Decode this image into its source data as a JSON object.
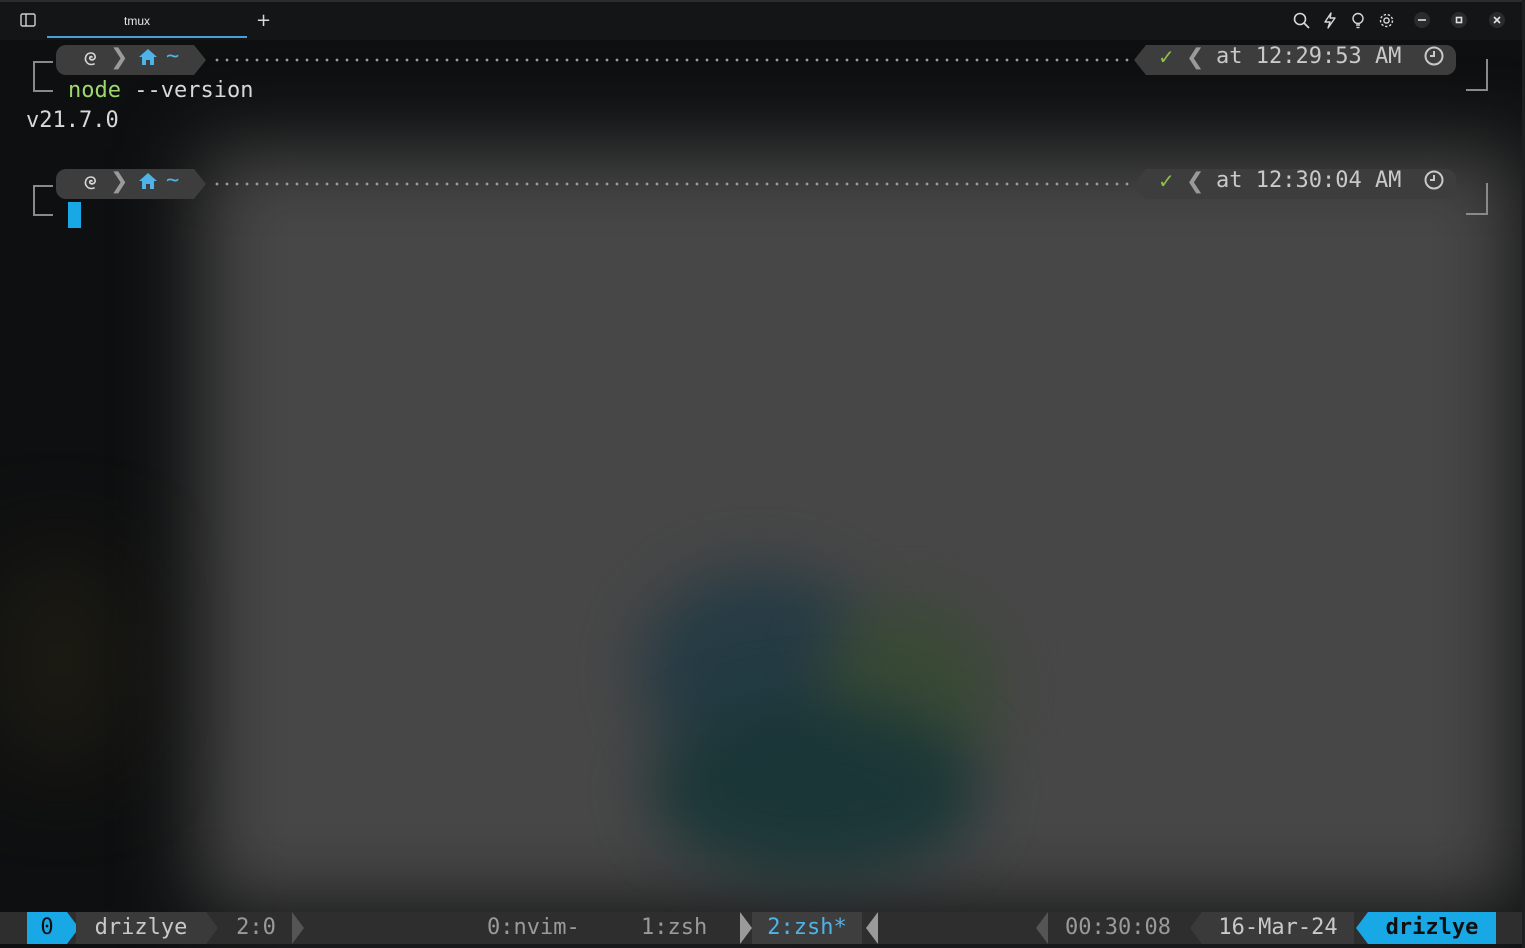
{
  "window": {
    "tab_title": "tmux",
    "new_tab_icon": "plus-icon",
    "sidebar_icon": "sidebar-toggle-icon",
    "toolbar_icons": [
      "search-icon",
      "lightning-icon",
      "lightbulb-icon",
      "gear-icon"
    ],
    "controls": [
      "minimize-icon",
      "maximize-icon",
      "close-icon"
    ]
  },
  "terminal": {
    "prompts": [
      {
        "os_icon": "debian-icon",
        "dir_icon": "home-icon",
        "dir": "~",
        "status": "✓",
        "time": "at 12:29:53 AM",
        "clock_icon": "clock-icon"
      },
      {
        "os_icon": "debian-icon",
        "dir_icon": "home-icon",
        "dir": "~",
        "status": "✓",
        "time": "at 12:30:04 AM",
        "clock_icon": "clock-icon"
      }
    ],
    "command_name": "node",
    "command_args": " --version",
    "output": "v21.7.0"
  },
  "tmux_status": {
    "session": "0",
    "user": "drizlye",
    "pane": "2:0",
    "windows": [
      "0:nvim-",
      "1:zsh",
      "2:zsh*"
    ],
    "active_window_index": 2,
    "uptime": "00:30:08",
    "date": "16-Mar-24",
    "host": "drizlye"
  },
  "colors": {
    "accent": "#19a8e6",
    "command": "#9fd86a",
    "status_ok": "#8ec04e",
    "prompt_bg": "#3d3d3d"
  }
}
